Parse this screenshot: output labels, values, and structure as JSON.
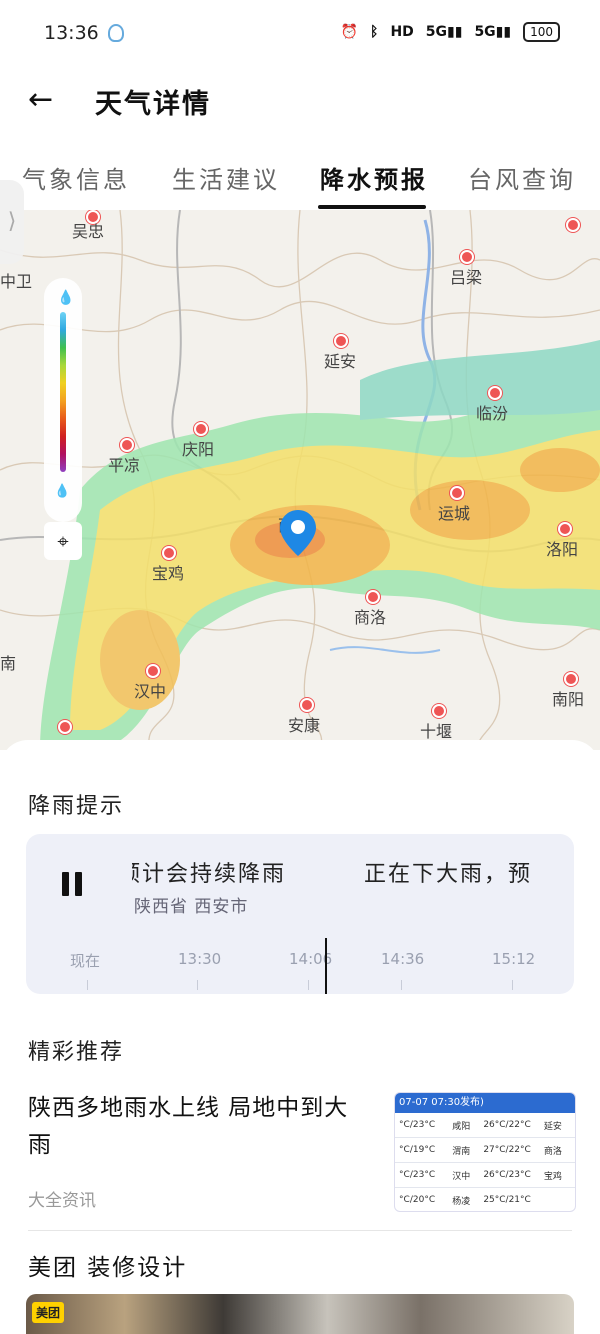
{
  "status_bar": {
    "time": "13:36",
    "network_1": "5G",
    "network_2": "5G",
    "hd_label": "HD",
    "battery": "100"
  },
  "app_bar": {
    "title": "天气详情"
  },
  "tabs": [
    {
      "label": "气象信息"
    },
    {
      "label": "生活建议"
    },
    {
      "label": "降水预报",
      "active": true
    },
    {
      "label": "台风查询"
    }
  ],
  "map": {
    "cities": [
      "吴忠",
      "吕梁",
      "中卫",
      "延安",
      "临汾",
      "庆阳",
      "平凉",
      "运城",
      "西安",
      "宝鸡",
      "洛阳",
      "商洛",
      "汉中",
      "南阳",
      "安康",
      "十堰",
      "南"
    ],
    "legend_colors": [
      "#6fd3f5",
      "#2fa8e0",
      "#3fbf4f",
      "#a8d83a",
      "#f0d020",
      "#f3a020",
      "#e85a1a",
      "#d02020",
      "#b01060",
      "#9040c0"
    ]
  },
  "rain_tip": {
    "section_title": "降雨提示",
    "message_part_1": "预计会持续降雨",
    "message_part_2": "正在下大雨，预",
    "location": "陕西省 西安市",
    "timeline": [
      "现在",
      "13:30",
      "14:06",
      "14:36",
      "15:12"
    ]
  },
  "recommend": {
    "section_title": "精彩推荐",
    "news_title": "陕西多地雨水上线 局地中到大雨",
    "news_source": "大全资讯",
    "thumb_header": "07-07 07:30发布)",
    "thumb_rows": [
      [
        "°C/23°C",
        "咸阳",
        "26°C/22°C",
        "延安"
      ],
      [
        "°C/19°C",
        "渭南",
        "27°C/22°C",
        "商洛"
      ],
      [
        "°C/23°C",
        "汉中",
        "26°C/23°C",
        "宝鸡"
      ],
      [
        "°C/20°C",
        "杨凌",
        "25°C/21°C",
        ""
      ]
    ]
  },
  "ad": {
    "title": "美团 装修设计",
    "badge": "美团"
  }
}
